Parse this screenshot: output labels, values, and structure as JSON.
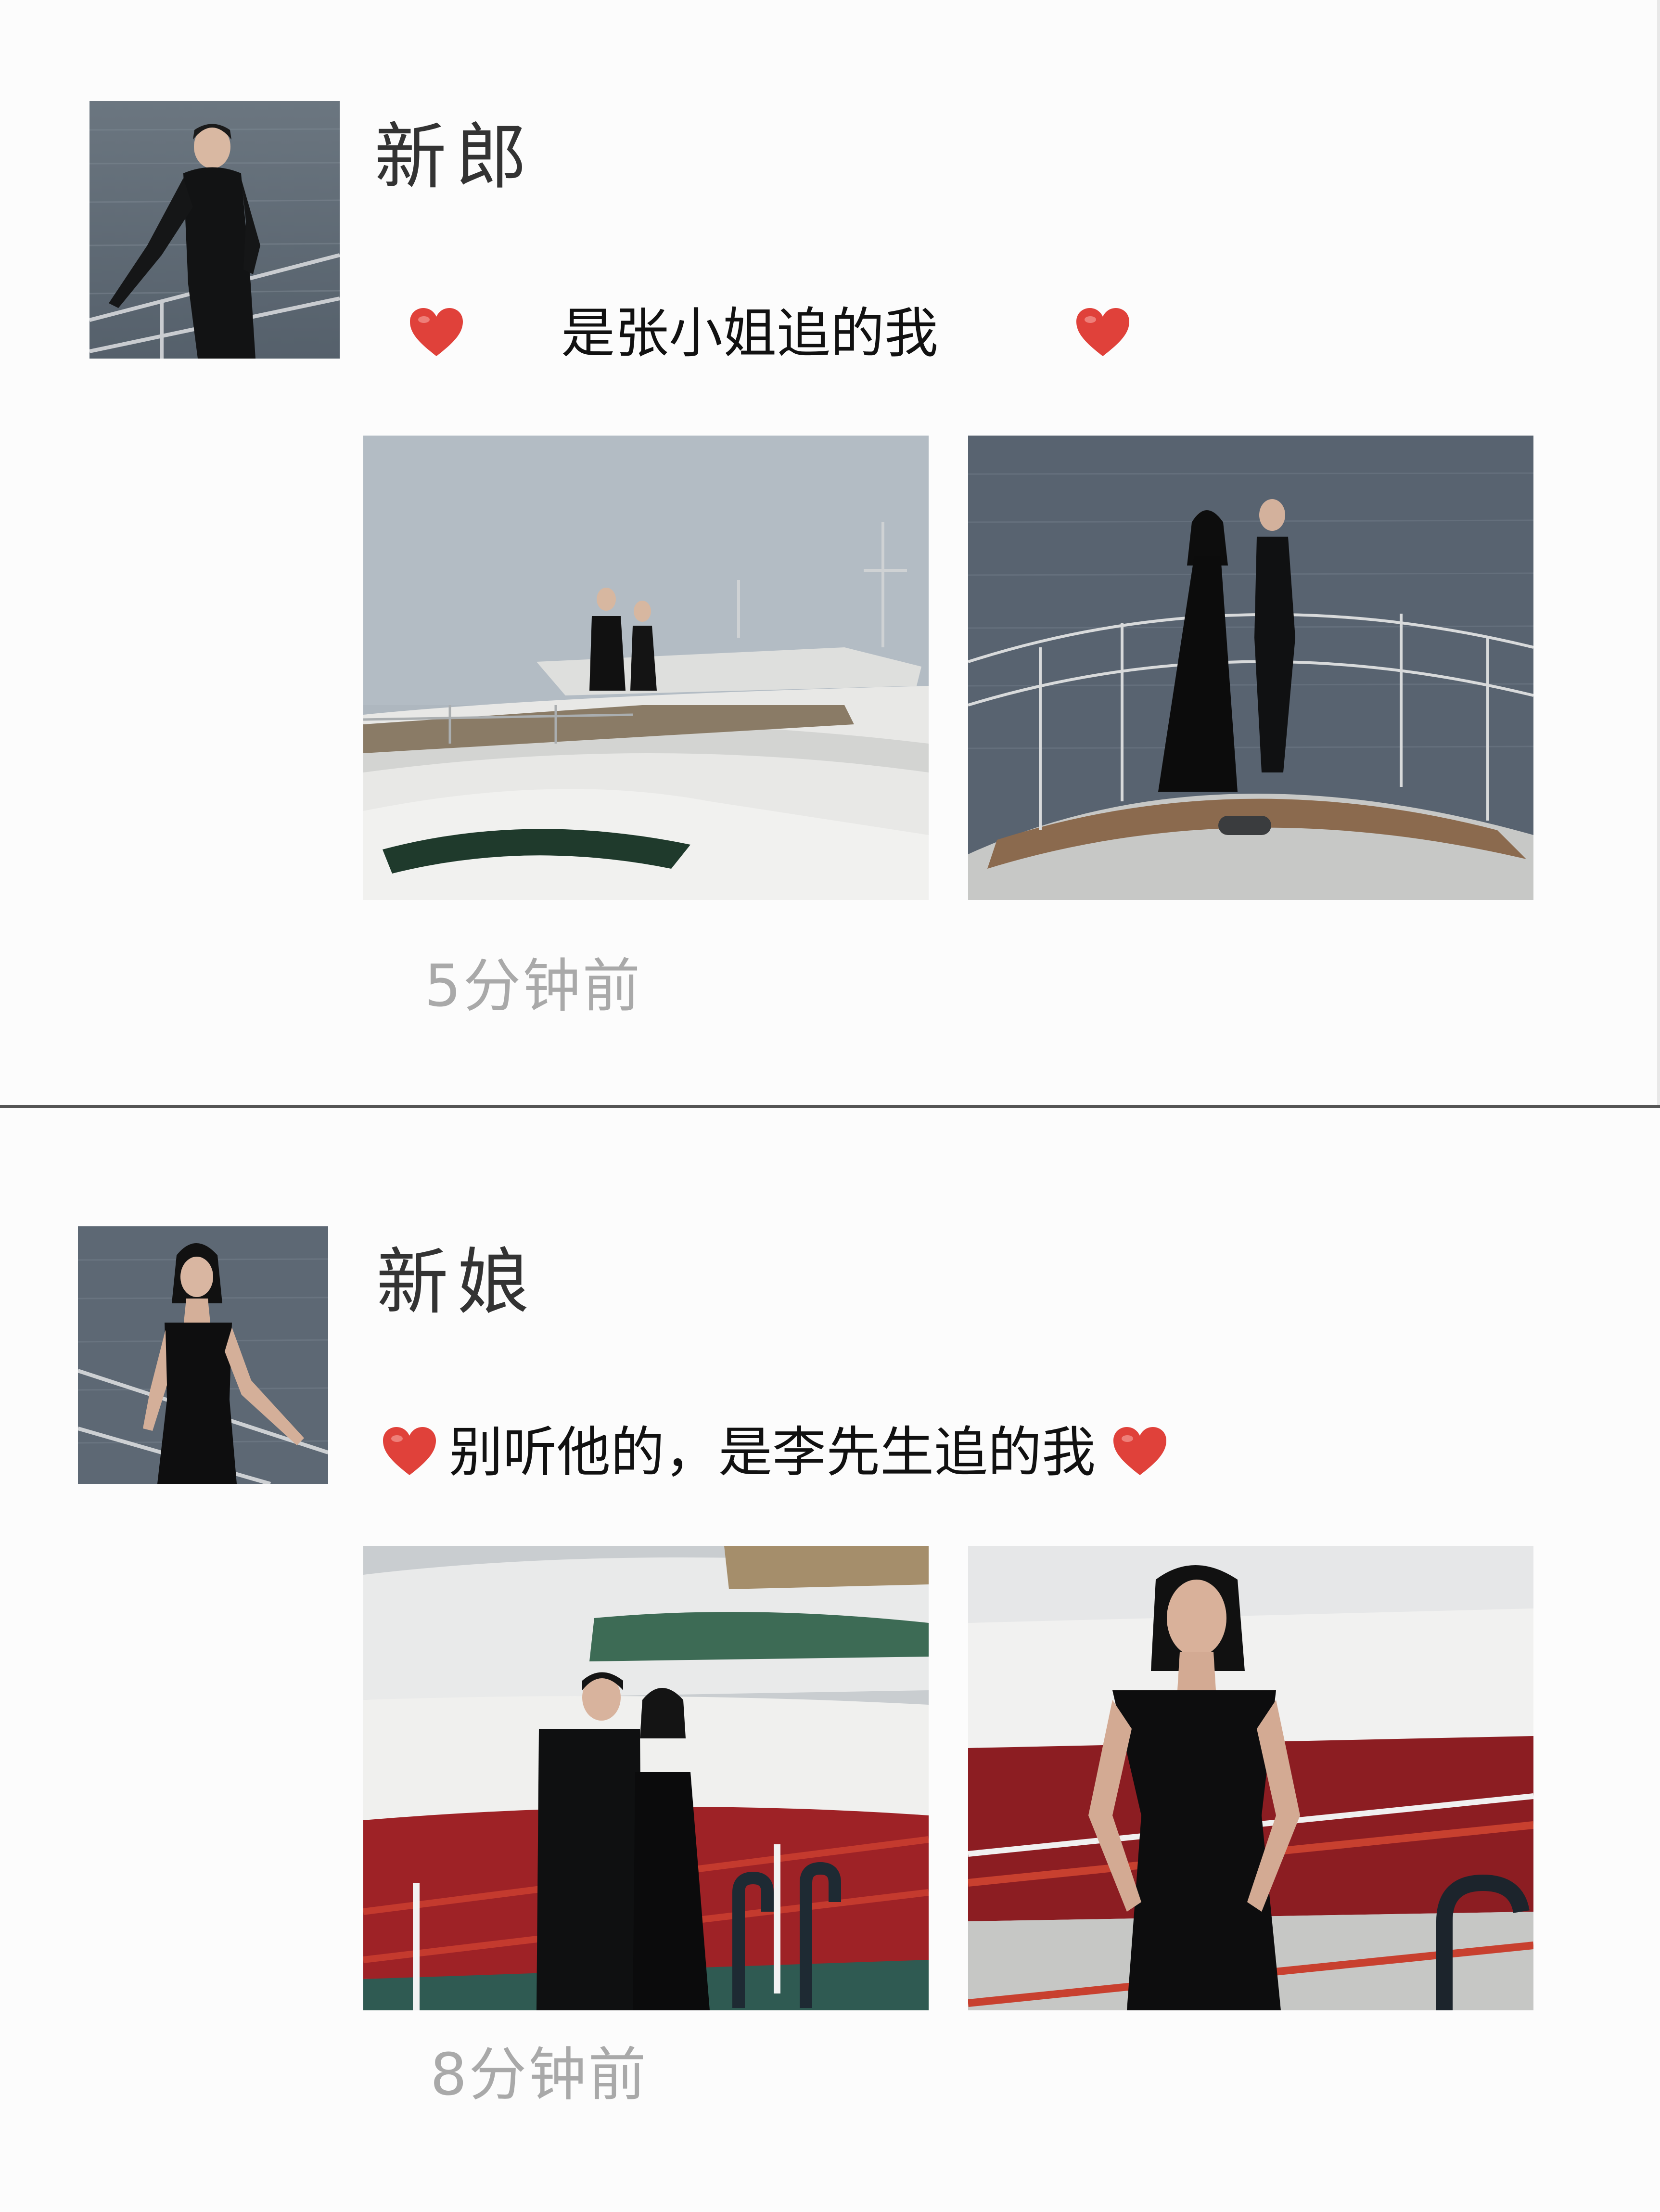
{
  "posts": [
    {
      "author": "新郎",
      "caption": "是张小姐追的我",
      "timestamp": "5分钟前",
      "avatar": "groom-on-yacht-photo",
      "photos": [
        "couple-on-yacht-upper-deck-photo",
        "couple-on-yacht-bow-photo"
      ]
    },
    {
      "author": "新娘",
      "caption": "别听他的，是李先生追的我",
      "timestamp": "8分钟前",
      "avatar": "bride-on-yacht-photo",
      "photos": [
        "couple-at-dock-railing-photo",
        "bride-at-dock-railing-photo"
      ]
    }
  ],
  "colors": {
    "heart": "#e0413a",
    "timestamp": "#a9a9a9",
    "divider": "#555555",
    "background": "#fcfcfc"
  }
}
